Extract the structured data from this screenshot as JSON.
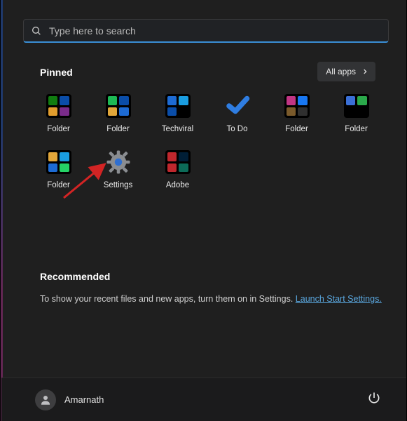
{
  "search": {
    "placeholder": "Type here to search"
  },
  "pinned": {
    "heading": "Pinned",
    "all_apps_label": "All apps",
    "items": [
      {
        "label": "Folder",
        "kind": "folder",
        "tiles": [
          "#107c10",
          "#0a4da8",
          "#e09c2d",
          "#7a2b8a"
        ]
      },
      {
        "label": "Folder",
        "kind": "folder",
        "tiles": [
          "#1db954",
          "#0a4da8",
          "#e0a63a",
          "#1d6bd4"
        ]
      },
      {
        "label": "Techviral",
        "kind": "folder",
        "tiles": [
          "#1d6bd4",
          "#1a9de0",
          "#0a4da8",
          "#000000"
        ]
      },
      {
        "label": "To Do",
        "kind": "check"
      },
      {
        "label": "Folder",
        "kind": "folder",
        "tiles": [
          "#c13584",
          "#1877f2",
          "#7a5a2b",
          "#2f2f2f"
        ]
      },
      {
        "label": "Folder",
        "kind": "folder",
        "tiles": [
          "#3a6fd6",
          "#2aa84a",
          "#000000",
          "#000000"
        ]
      },
      {
        "label": "Folder",
        "kind": "folder",
        "tiles": [
          "#e0a63a",
          "#1a9de0",
          "#1d6bd4",
          "#25d366"
        ]
      },
      {
        "label": "Settings",
        "kind": "gear"
      },
      {
        "label": "Adobe",
        "kind": "folder",
        "tiles": [
          "#c0272d",
          "#001e36",
          "#c0272d",
          "#0c6b58"
        ]
      }
    ]
  },
  "recommended": {
    "heading": "Recommended",
    "message": "To show your recent files and new apps, turn them on in Settings. ",
    "link_text": "Launch Start Settings."
  },
  "user": {
    "name": "Amarnath"
  },
  "colors": {
    "accent": "#3a8fd6"
  }
}
